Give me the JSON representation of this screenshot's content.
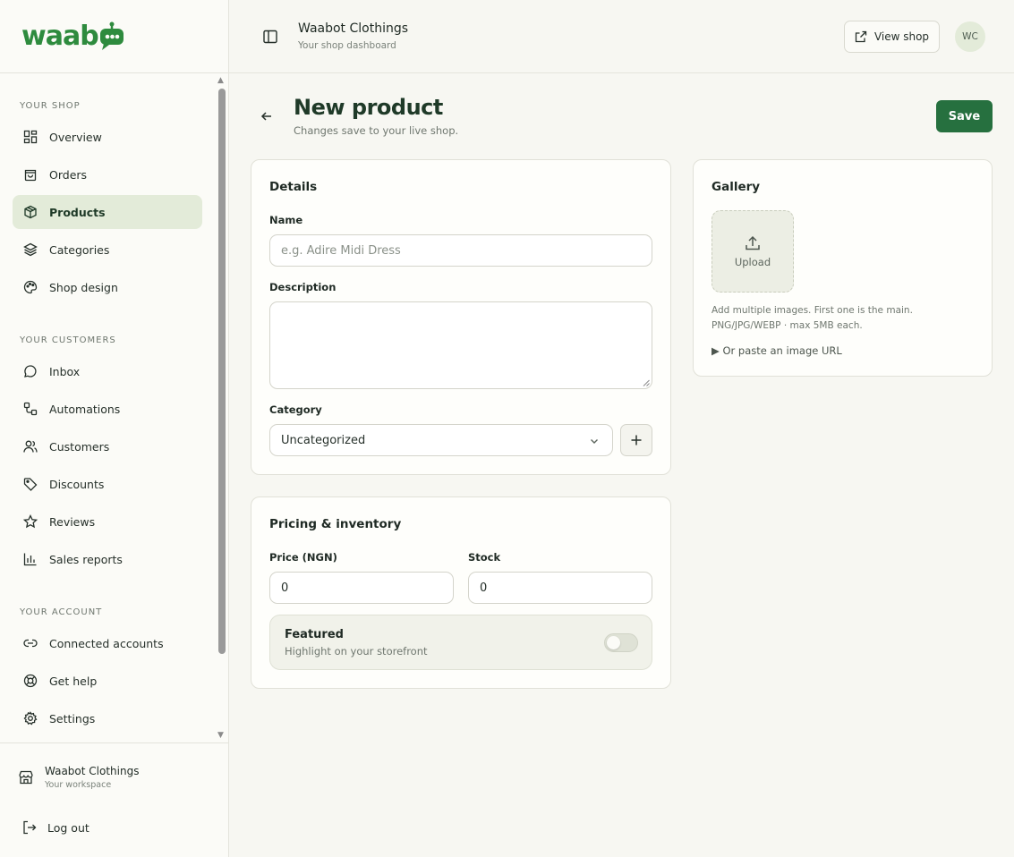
{
  "brand": {
    "logo_text": "waab",
    "accent": "#2e8b3e",
    "primary_button": "#26703f"
  },
  "topbar": {
    "shop_name": "Waabot Clothings",
    "shop_sub": "Your shop dashboard",
    "view_shop_label": "View shop",
    "avatar_initials": "WC"
  },
  "sidebar": {
    "sections": [
      {
        "label": "YOUR SHOP"
      },
      {
        "label": "YOUR CUSTOMERS"
      },
      {
        "label": "YOUR ACCOUNT"
      }
    ],
    "items": [
      {
        "label": "Overview",
        "icon": "grid-icon"
      },
      {
        "label": "Orders",
        "icon": "bag-icon"
      },
      {
        "label": "Products",
        "icon": "box-icon",
        "active": true
      },
      {
        "label": "Categories",
        "icon": "layers-icon"
      },
      {
        "label": "Shop design",
        "icon": "palette-icon"
      },
      {
        "label": "Inbox",
        "icon": "chat-icon"
      },
      {
        "label": "Automations",
        "icon": "workflow-icon"
      },
      {
        "label": "Customers",
        "icon": "users-icon"
      },
      {
        "label": "Discounts",
        "icon": "tag-icon"
      },
      {
        "label": "Reviews",
        "icon": "star-icon"
      },
      {
        "label": "Sales reports",
        "icon": "bar-chart-icon"
      },
      {
        "label": "Connected accounts",
        "icon": "link-icon"
      },
      {
        "label": "Get help",
        "icon": "lifebuoy-icon"
      },
      {
        "label": "Settings",
        "icon": "gear-icon"
      }
    ],
    "workspace": {
      "name": "Waabot Clothings",
      "sub": "Your workspace"
    },
    "logout_label": "Log out"
  },
  "header": {
    "title": "New product",
    "subtitle": "Changes save to your live shop.",
    "save_label": "Save"
  },
  "details": {
    "title": "Details",
    "name_label": "Name",
    "name_placeholder": "e.g. Adire Midi Dress",
    "name_value": "",
    "description_label": "Description",
    "description_value": "",
    "category_label": "Category",
    "category_value": "Uncategorized",
    "add_category_label": "+"
  },
  "pricing": {
    "title": "Pricing & inventory",
    "price_label": "Price (NGN)",
    "price_value": "0",
    "stock_label": "Stock",
    "stock_value": "0",
    "featured_title": "Featured",
    "featured_sub": "Highlight on your storefront",
    "featured_on": false
  },
  "gallery": {
    "title": "Gallery",
    "upload_label": "Upload",
    "note_line1": "Add multiple images. First one is the main.",
    "note_line2": "PNG/JPG/WEBP · max 5MB each.",
    "paste_url_label": "▶  Or paste an image URL"
  }
}
